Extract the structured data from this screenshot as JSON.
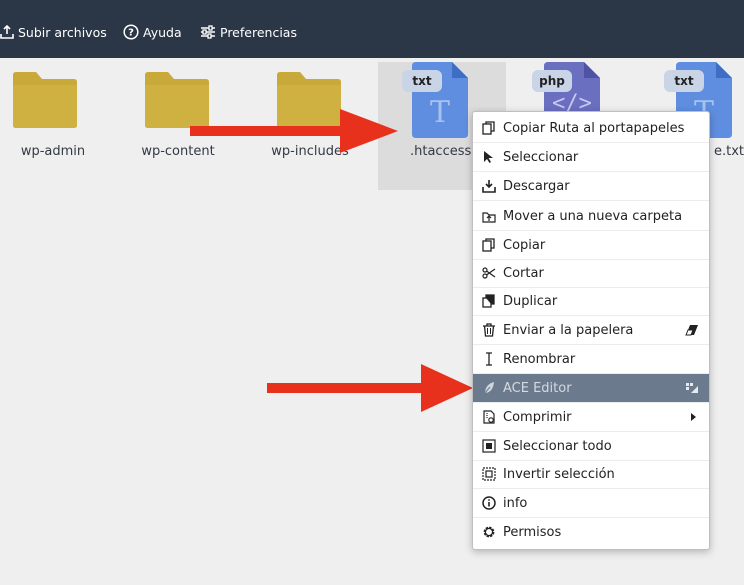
{
  "toolbar": {
    "upload_label": "Subir archivos",
    "help_label": "Ayuda",
    "prefs_label": "Preferencias",
    "bg_color": "#2b3647"
  },
  "files": [
    {
      "name": "wp-admin",
      "type": "folder"
    },
    {
      "name": "wp-content",
      "type": "folder"
    },
    {
      "name": "wp-includes",
      "type": "folder"
    },
    {
      "name": ".htaccess",
      "type": "txt",
      "badge": "txt",
      "selected": true
    },
    {
      "name": "",
      "type": "php",
      "badge": "php"
    },
    {
      "name": "e.txt",
      "type": "txt",
      "badge": "txt"
    }
  ],
  "context_menu": {
    "items": [
      {
        "label": "Copiar Ruta al portapapeles",
        "icon": "copy-path-icon"
      },
      {
        "label": "Seleccionar",
        "icon": "cursor-icon"
      },
      {
        "label": "Descargar",
        "icon": "download-icon"
      },
      {
        "label": "Mover a una nueva carpeta",
        "icon": "move-folder-icon"
      },
      {
        "label": "Copiar",
        "icon": "copy-icon"
      },
      {
        "label": "Cortar",
        "icon": "scissors-icon"
      },
      {
        "label": "Duplicar",
        "icon": "duplicate-icon"
      },
      {
        "label": "Enviar a la papelera",
        "icon": "trash-icon",
        "shortcut_icon": "eraser-icon"
      },
      {
        "label": "Renombrar",
        "icon": "text-cursor-icon"
      },
      {
        "label": "ACE Editor",
        "icon": "feather-icon",
        "shortcut_icon": "editor-icon",
        "active": true
      },
      {
        "label": "Comprimir",
        "icon": "archive-icon",
        "submenu": true
      },
      {
        "label": "Seleccionar todo",
        "icon": "select-all-icon"
      },
      {
        "label": "Invertir selección",
        "icon": "invert-selection-icon"
      },
      {
        "label": "info",
        "icon": "info-icon"
      },
      {
        "label": "Permisos",
        "icon": "gear-icon"
      }
    ],
    "active_color": "#6b7a8c"
  },
  "colors": {
    "folder": "#c9a93a",
    "txt_doc": "#5f8ee0",
    "php_doc": "#6b6fc0",
    "arrow": "#e8311c"
  }
}
